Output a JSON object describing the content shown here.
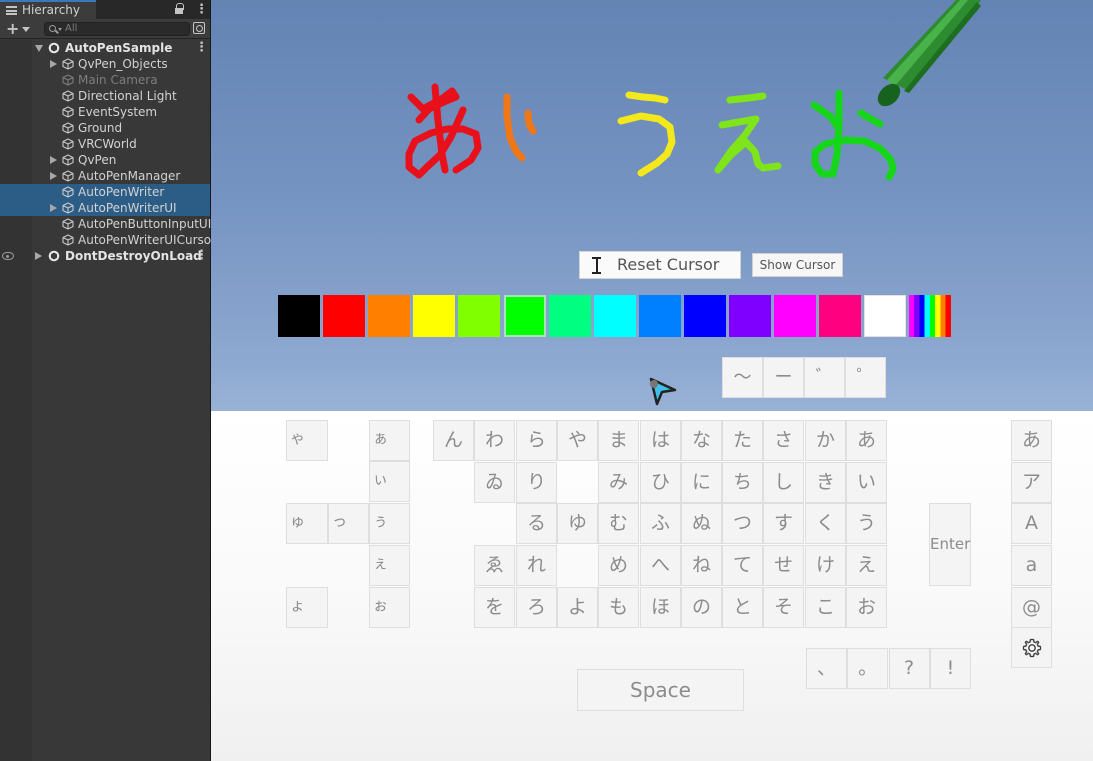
{
  "hierarchy": {
    "tab_label": "Hierarchy",
    "search_placeholder": "All",
    "items": [
      {
        "label": "AutoPenSample",
        "type": "scene",
        "expand": "open"
      },
      {
        "label": "QvPen_Objects",
        "type": "object",
        "expand": "closed"
      },
      {
        "label": "Main Camera",
        "type": "object",
        "expand": "none",
        "disabled": true
      },
      {
        "label": "Directional Light",
        "type": "object",
        "expand": "none"
      },
      {
        "label": "EventSystem",
        "type": "object",
        "expand": "none"
      },
      {
        "label": "Ground",
        "type": "object",
        "expand": "none"
      },
      {
        "label": "VRCWorld",
        "type": "object",
        "expand": "none"
      },
      {
        "label": "QvPen",
        "type": "object",
        "expand": "closed"
      },
      {
        "label": "AutoPenManager",
        "type": "object",
        "expand": "closed"
      },
      {
        "label": "AutoPenWriter",
        "type": "object",
        "expand": "none",
        "selected": true
      },
      {
        "label": "AutoPenWriterUI",
        "type": "object",
        "expand": "closed",
        "selected": true
      },
      {
        "label": "AutoPenButtonInputUI",
        "type": "object",
        "expand": "none"
      },
      {
        "label": "AutoPenWriterUICursor",
        "type": "object",
        "expand": "none"
      },
      {
        "label": "DontDestroyOnLoad",
        "type": "scene",
        "expand": "closed",
        "hidden_eye": true
      }
    ]
  },
  "game": {
    "drawn_text": [
      "あ",
      "い",
      "う",
      "え",
      "お"
    ],
    "drawn_colors": [
      "#e8101a",
      "#f07716",
      "#f2e81c",
      "#7fe41a",
      "#16d61a"
    ],
    "reset_cursor_label": "Reset Cursor",
    "show_cursor_label": "Show Cursor",
    "palette": [
      "#000000",
      "#ff0000",
      "#ff8000",
      "#ffff00",
      "#80ff00",
      "#00ff00",
      "#00ff80",
      "#00ffff",
      "#0080ff",
      "#0000ff",
      "#8000ff",
      "#ff00ff",
      "#ff0080",
      "#ffffff",
      "rainbow"
    ],
    "selected_color_index": 5,
    "rainbow_colors": [
      "#ff00ff",
      "#8000ff",
      "#0000ff",
      "#00ffff",
      "#00ff00",
      "#ffff00",
      "#ff8000",
      "#ff0000"
    ],
    "symbol_keys": [
      "〜",
      "ー",
      "゛",
      "゜"
    ],
    "small_keys": [
      "ゃ",
      "ぁ",
      "ぃ",
      "ゅ",
      "っ",
      "ぅ",
      "ぇ",
      "ょ",
      "ぉ"
    ],
    "grid": [
      [
        "ん",
        "わ",
        "ら",
        "や",
        "ま",
        "は",
        "な",
        "た",
        "さ",
        "か",
        "あ"
      ],
      [
        "",
        "ゐ",
        "り",
        "",
        "み",
        "ひ",
        "に",
        "ち",
        "し",
        "き",
        "い"
      ],
      [
        "",
        "",
        "る",
        "ゆ",
        "む",
        "ふ",
        "ぬ",
        "つ",
        "す",
        "く",
        "う"
      ],
      [
        "",
        "ゑ",
        "れ",
        "",
        "め",
        "へ",
        "ね",
        "て",
        "せ",
        "け",
        "え"
      ],
      [
        "",
        "を",
        "ろ",
        "よ",
        "も",
        "ほ",
        "の",
        "と",
        "そ",
        "こ",
        "お"
      ]
    ],
    "enter_label": "Enter",
    "mode_keys": [
      "あ",
      "ア",
      "A",
      "a",
      "@"
    ],
    "settings_icon": "gear-icon",
    "punct_keys": [
      "、",
      "。",
      "?",
      "!"
    ],
    "space_label": "Space"
  }
}
